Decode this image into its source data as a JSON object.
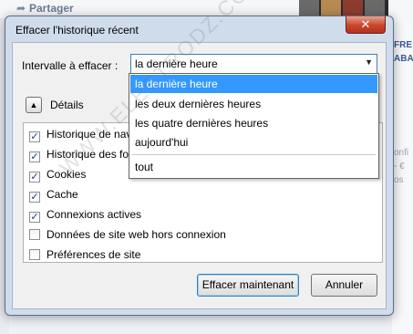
{
  "background": {
    "share_label": "Partager",
    "side_text": [
      "FRE",
      "ABA"
    ],
    "side_gray": [
      "onfi",
      "- €",
      "os"
    ]
  },
  "dialog": {
    "title": "Effacer l'historique récent",
    "close_label": "✕",
    "interval_label": "Intervalle à effacer :",
    "select_value": "la dernière heure",
    "details_label": "Détails",
    "options": [
      {
        "label": "la dernière heure",
        "selected": true
      },
      {
        "label": "les deux dernières heures",
        "selected": false
      },
      {
        "label": "les quatre dernières heures",
        "selected": false
      },
      {
        "label": "aujourd'hui",
        "selected": false
      },
      {
        "label": "tout",
        "selected": false
      }
    ],
    "items": [
      {
        "label": "Historique de navigation et des téléchargements",
        "checked": true
      },
      {
        "label": "Historique des formulaires et des recherches",
        "checked": true
      },
      {
        "label": "Cookies",
        "checked": true
      },
      {
        "label": "Cache",
        "checked": true
      },
      {
        "label": "Connexions actives",
        "checked": true
      },
      {
        "label": "Données de site web hors connexion",
        "checked": false
      },
      {
        "label": "Préférences de site",
        "checked": false
      }
    ],
    "clear_button": "Effacer maintenant",
    "cancel_button": "Annuler"
  },
  "watermark": "WWW.ELECTRODZ.COM",
  "colors": {
    "selection": "#3399ff",
    "window_frame": "#cfdcec",
    "close_button": "#c8452b"
  }
}
